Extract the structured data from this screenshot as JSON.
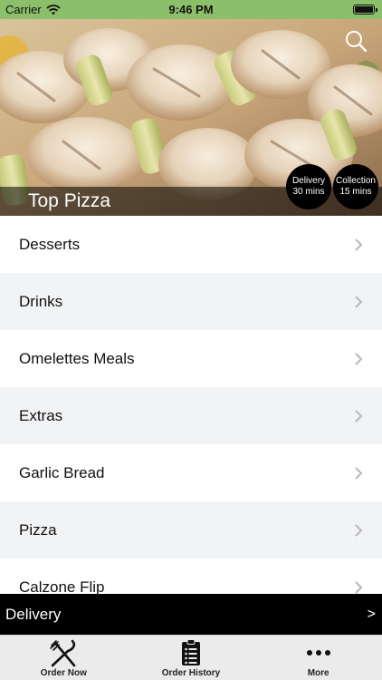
{
  "status_bar": {
    "carrier": "Carrier",
    "time": "9:46 PM"
  },
  "hero": {
    "store_name": "Top Pizza",
    "delivery_badge": {
      "label": "Delivery",
      "time": "30 mins"
    },
    "collection_badge": {
      "label": "Collection",
      "time": "15 mins"
    },
    "search_icon": "search-icon"
  },
  "menu_categories": [
    "Desserts",
    "Drinks",
    "Omelettes Meals",
    "Extras",
    "Garlic Bread",
    "Pizza",
    "Calzone Flip"
  ],
  "delivery_bar": {
    "label": "Delivery",
    "arrow": ">"
  },
  "tab_bar": {
    "tabs": [
      {
        "label": "Order Now",
        "icon": "fork-knife-icon"
      },
      {
        "label": "Order History",
        "icon": "clipboard-list-icon"
      },
      {
        "label": "More",
        "icon": "ellipsis-icon"
      }
    ]
  },
  "colors": {
    "status_bar": "#8bbf6a",
    "row_alt": "#f2f3f5",
    "bar_black": "#000000"
  }
}
